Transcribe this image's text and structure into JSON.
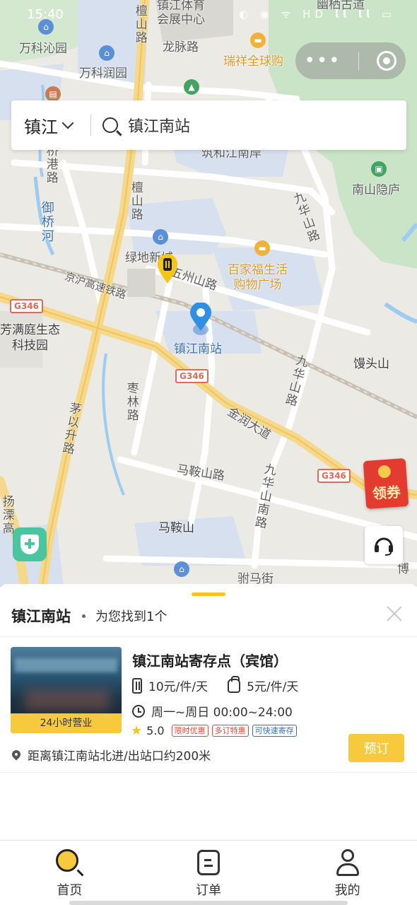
{
  "status_bar": {
    "time": "15:40",
    "icons_text": "◐ ◉ ᯤ HD 𝗹𝗹 𝗹𝗹 ▭"
  },
  "map": {
    "labels": {
      "wanke_qinyuan": "万科沁园",
      "wanke_runyuan": "万科润园",
      "tiyu_center": "镇江体育\n会展中心",
      "longmai_road": "龙脉路",
      "ruixiang": "瑞祥全球购",
      "youqi_gudao": "幽栖古道",
      "tanshan_road_top": "檀山路",
      "tanshan_road": "檀山路",
      "zhuhe_jiangnan": "筑和江南岸",
      "nanshan_yinlu": "南山隐庐",
      "jiuhua_road_top": "九华山路",
      "jiuhua_road_mid": "九华山路",
      "jiuhua_road_bottom": "九华山南路",
      "yuqiao_river": "御桥河",
      "linggang_road": "桥港路",
      "lvdi_city": "绿地新城",
      "baijiafu": "百家福生活\n购物广场",
      "wuzhou_road": "五州山路",
      "jinghu_railway": "京沪高速铁路",
      "station": "镇江南站",
      "fangmanting": "芳满庭生态\n科技园",
      "mantou_mountain": "馒头山",
      "zaolin_road": "枣林路",
      "maoyisheng_road": "茅以升路",
      "jinrun_avenue": "金润大道",
      "maanshan_road": "马鞍山路",
      "maanshan": "马鞍山",
      "yangliyuan": "扬溧高",
      "fuma_street": "驸马街",
      "bo": "博",
      "g346_a": "G346",
      "g346_b": "G346",
      "g346_c": "G346"
    }
  },
  "search": {
    "city": "镇江",
    "query": "镇江南站"
  },
  "coupon": {
    "label": "领券"
  },
  "sheet": {
    "title": "镇江南站",
    "found_text": "为您找到1个"
  },
  "store": {
    "name": "镇江南站寄存点（宾馆）",
    "thumb_badge": "24小时营业",
    "price_luggage": "10元/件/天",
    "price_bag": "5元/件/天",
    "hours": "周一~周日 00:00~24:00",
    "rating": "5.0",
    "tags": [
      "限时优惠",
      "多订特惠",
      "可快速寄存"
    ],
    "distance": "距离镇江南站北进/出站口约200米",
    "book_label": "预订"
  },
  "tabbar": {
    "home": "首页",
    "orders": "订单",
    "mine": "我的"
  },
  "colors": {
    "accent": "#f7c93d",
    "pin": "#2f8fe0"
  }
}
